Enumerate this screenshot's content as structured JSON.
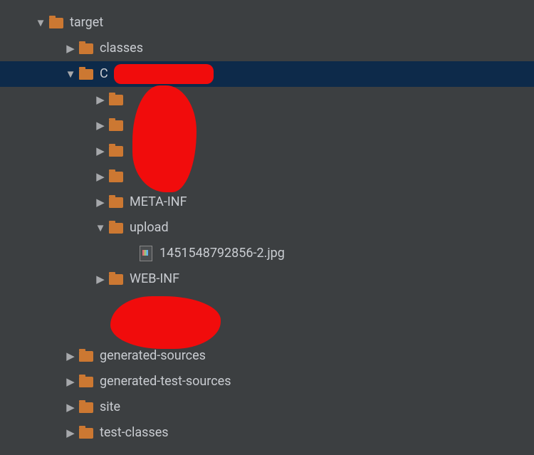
{
  "tree": {
    "root": {
      "label": "target",
      "expanded": true
    },
    "classes": {
      "label": "classes",
      "expanded": false
    },
    "redacted_main": {
      "label": "C",
      "expanded": true
    },
    "child1": {
      "label": "",
      "expanded": false
    },
    "child2": {
      "label": "",
      "expanded": false
    },
    "child3": {
      "label": "",
      "expanded": false
    },
    "child4": {
      "label": "",
      "expanded": false
    },
    "metainf": {
      "label": "META-INF",
      "expanded": false
    },
    "upload": {
      "label": "upload",
      "expanded": true
    },
    "file_img": {
      "label": "1451548792856-2.jpg"
    },
    "webinf": {
      "label": "WEB-INF",
      "expanded": false
    },
    "child_hidden5": {
      "label": "",
      "expanded": false
    },
    "child_hidden6": {
      "label": "",
      "expanded": false
    },
    "gen_src": {
      "label": "generated-sources",
      "expanded": false
    },
    "gen_test_src": {
      "label": "generated-test-sources",
      "expanded": false
    },
    "site": {
      "label": "site",
      "expanded": false
    },
    "test_classes": {
      "label": "test-classes",
      "expanded": false
    }
  }
}
